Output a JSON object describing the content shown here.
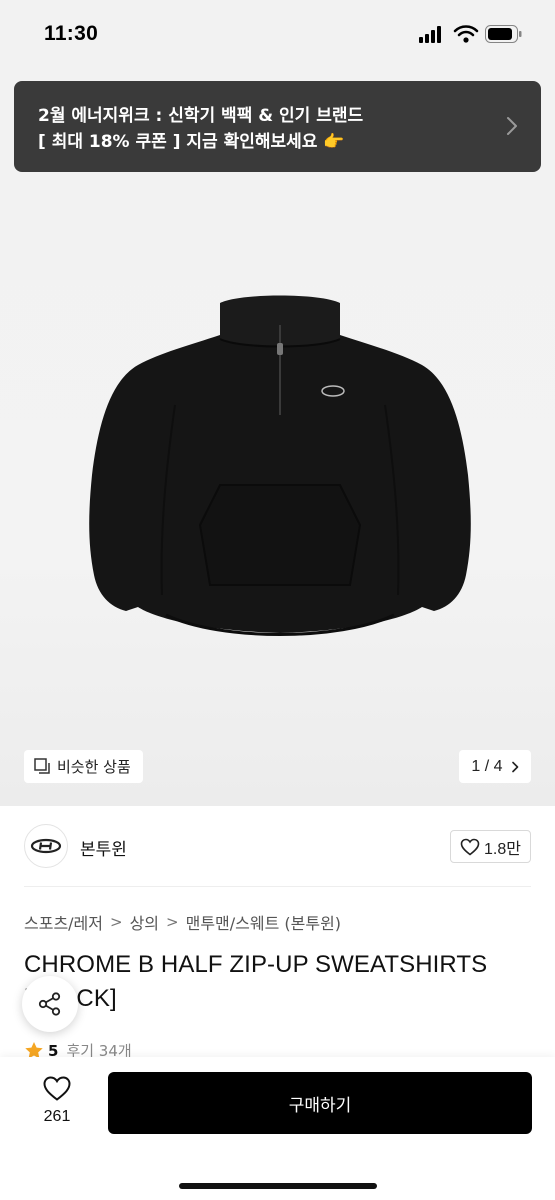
{
  "status_bar": {
    "time": "11:30"
  },
  "promo": {
    "line1": "2월 에너지위크 : 신학기 백팩 & 인기 브랜드",
    "line2": "[ 최대 18% 쿠폰 ] 지금 확인해보세요 👉"
  },
  "gallery": {
    "similar_label": "비슷한 상품",
    "page_indicator": "1 / 4"
  },
  "brand": {
    "name": "본투윈",
    "likes": "1.8만"
  },
  "breadcrumb": {
    "items": [
      "스포츠/레저",
      "상의",
      "맨투맨/스웨트 (본투윈)"
    ]
  },
  "product": {
    "title": "CHROME B HALF ZIP-UP SWEATSHIRTS [BLACK]",
    "rating": "5",
    "review_count": "후기 34개"
  },
  "bottom_bar": {
    "wish_count": "261",
    "buy_label": "구매하기"
  },
  "colors": {
    "accent": "#000000",
    "promo_bg": "#3a3a3a",
    "star": "#f5a623"
  },
  "icons": [
    "signal-icon",
    "wifi-icon",
    "battery-icon",
    "chevron-right-icon",
    "similar-icon",
    "heart-icon",
    "share-icon",
    "star-icon"
  ]
}
